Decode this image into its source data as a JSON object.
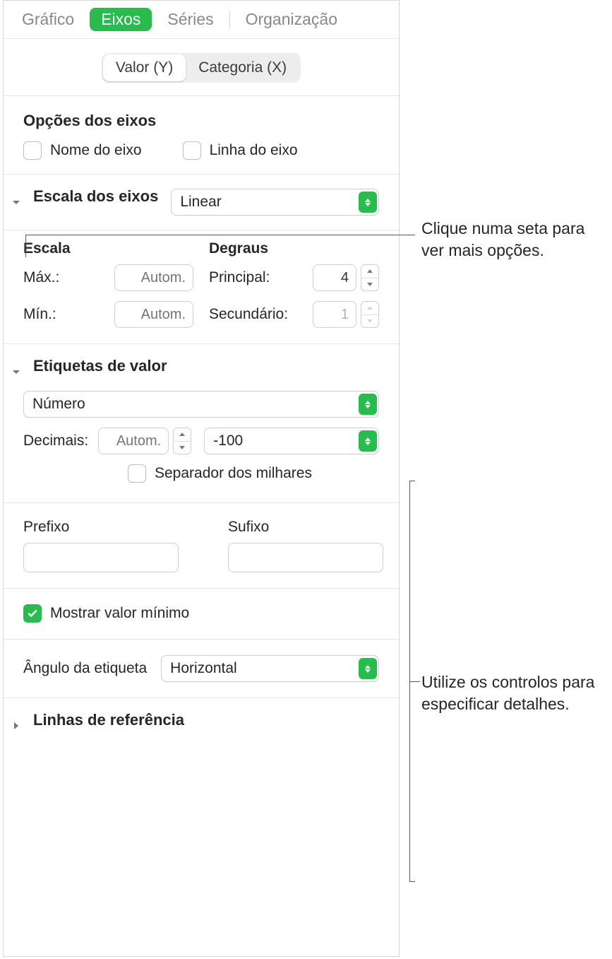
{
  "tabs": {
    "chart": "Gráfico",
    "axes": "Eixos",
    "series": "Séries",
    "organization": "Organização"
  },
  "axisSwitch": {
    "valueY": "Valor (Y)",
    "categoryX": "Categoria (X)"
  },
  "axisOptions": {
    "title": "Opções dos eixos",
    "nameLabel": "Nome do eixo",
    "lineLabel": "Linha do eixo"
  },
  "axisScale": {
    "title": "Escala dos eixos",
    "typeValue": "Linear",
    "scaleHeader": "Escala",
    "stepsHeader": "Degraus",
    "maxLabel": "Máx.:",
    "minLabel": "Mín.:",
    "autoPlaceholder": "Autom.",
    "majorLabel": "Principal:",
    "minorLabel": "Secundário:",
    "majorValue": "4",
    "minorValue": "1"
  },
  "valueLabels": {
    "title": "Etiquetas de valor",
    "formatValue": "Número",
    "decimalsLabel": "Decimais:",
    "decimalsPlaceholder": "Autom.",
    "negativeValue": "-100",
    "thousandsLabel": "Separador dos milhares",
    "prefixLabel": "Prefixo",
    "suffixLabel": "Sufixo",
    "showMinLabel": "Mostrar valor mínimo",
    "angleLabel": "Ângulo da etiqueta",
    "angleValue": "Horizontal"
  },
  "refLines": {
    "title": "Linhas de referência"
  },
  "callouts": {
    "top": "Clique numa seta para ver mais opções.",
    "bottom": "Utilize os controlos para especificar detalhes."
  }
}
